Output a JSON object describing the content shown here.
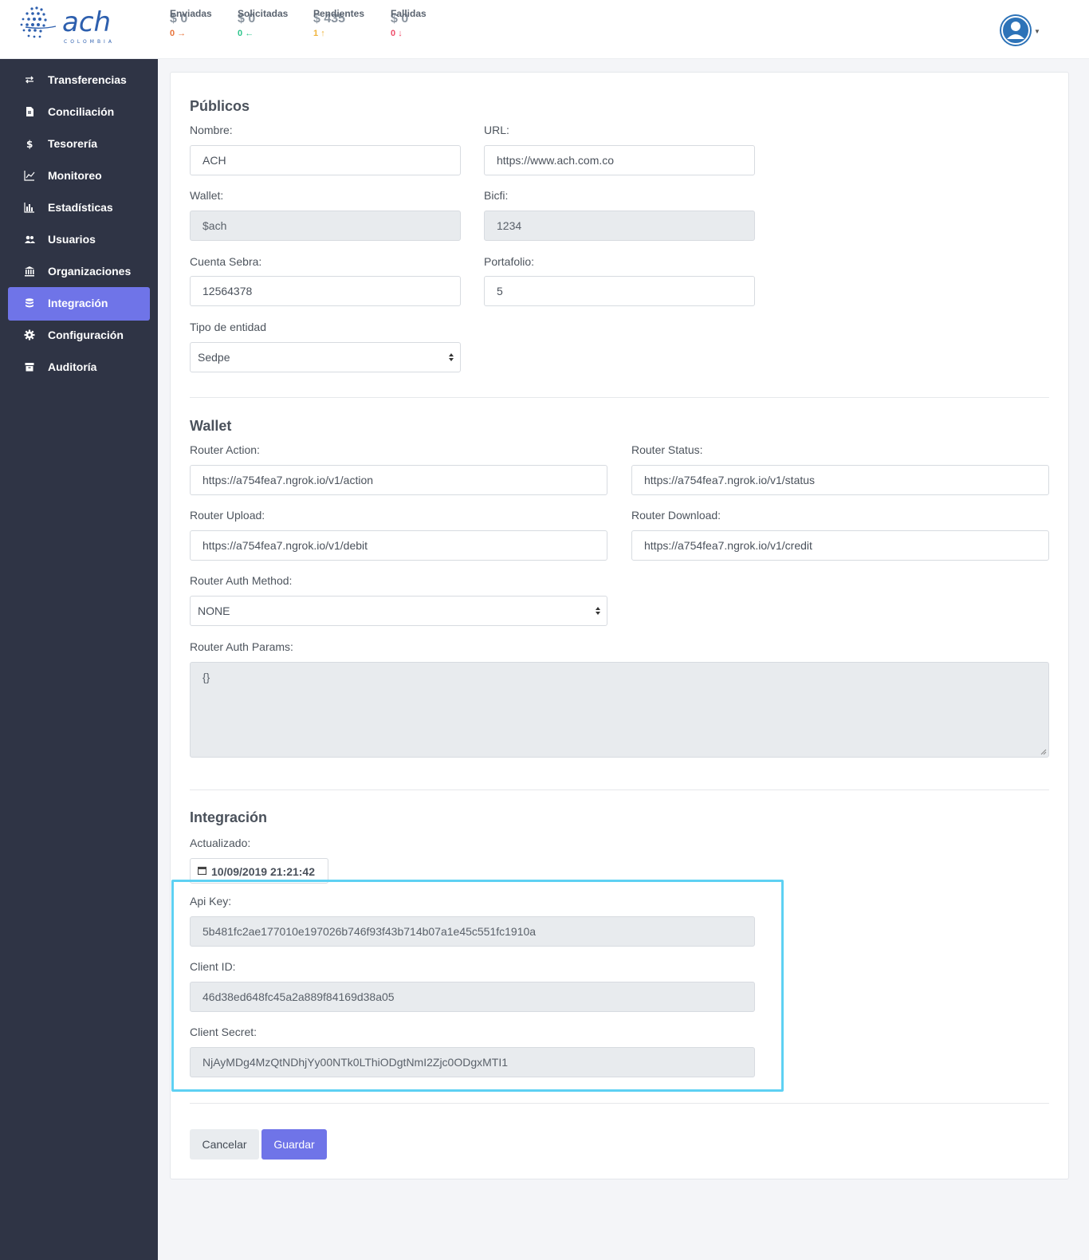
{
  "brand": {
    "logo_text": "ach",
    "logo_sub": "COLOMBIA"
  },
  "stats": [
    {
      "label": "Enviadas",
      "value": "$ 0",
      "count": "0",
      "arrow": "→",
      "color": "#e8743b"
    },
    {
      "label": "Solicitadas",
      "value": "$ 0",
      "count": "0",
      "arrow": "←",
      "color": "#2dc58c"
    },
    {
      "label": "Pendientes",
      "value": "$ 435",
      "count": "1",
      "arrow": "↑",
      "color": "#f0b43c"
    },
    {
      "label": "Fallidas",
      "value": "$ 0",
      "count": "0",
      "arrow": "↓",
      "color": "#ee4d6a"
    }
  ],
  "sidebar": {
    "items": [
      {
        "label": "Transferencias",
        "icon": "transfer-icon"
      },
      {
        "label": "Conciliación",
        "icon": "document-icon"
      },
      {
        "label": "Tesorería",
        "icon": "dollar-icon"
      },
      {
        "label": "Monitoreo",
        "icon": "line-chart-icon"
      },
      {
        "label": "Estadísticas",
        "icon": "bar-chart-icon"
      },
      {
        "label": "Usuarios",
        "icon": "users-icon"
      },
      {
        "label": "Organizaciones",
        "icon": "bank-icon"
      },
      {
        "label": "Integración",
        "icon": "database-icon",
        "active": true
      },
      {
        "label": "Configuración",
        "icon": "gear-icon"
      },
      {
        "label": "Auditoría",
        "icon": "archive-icon"
      }
    ]
  },
  "publicos": {
    "title": "Públicos",
    "nombre_label": "Nombre:",
    "nombre_value": "ACH",
    "url_label": "URL:",
    "url_value": "https://www.ach.com.co",
    "wallet_label": "Wallet:",
    "wallet_value": "$ach",
    "bicfi_label": "Bicfi:",
    "bicfi_value": "1234",
    "cuenta_label": "Cuenta Sebra:",
    "cuenta_value": "12564378",
    "portafolio_label": "Portafolio:",
    "portafolio_value": "5",
    "tipo_label": "Tipo de entidad",
    "tipo_value": "Sedpe"
  },
  "wallet": {
    "title": "Wallet",
    "action_label": "Router Action:",
    "action_value": "https://a754fea7.ngrok.io/v1/action",
    "status_label": "Router Status:",
    "status_value": "https://a754fea7.ngrok.io/v1/status",
    "upload_label": "Router Upload:",
    "upload_value": "https://a754fea7.ngrok.io/v1/debit",
    "download_label": "Router Download:",
    "download_value": "https://a754fea7.ngrok.io/v1/credit",
    "auth_method_label": "Router Auth Method:",
    "auth_method_value": "NONE",
    "auth_params_label": "Router Auth Params:",
    "auth_params_value": "{}"
  },
  "integracion": {
    "title": "Integración",
    "updated_label": "Actualizado:",
    "updated_value": "10/09/2019 21:21:42",
    "apikey_label": "Api Key:",
    "apikey_value": "5b481fc2ae177010e197026b746f93f43b714b07a1e45c551fc1910a",
    "clientid_label": "Client ID:",
    "clientid_value": "46d38ed648fc45a2a889f84169d38a05",
    "secret_label": "Client Secret:",
    "secret_value": "NjAyMDg4MzQtNDhjYy00NTk0LThiODgtNmI2Zjc0ODgxMTI1"
  },
  "actions": {
    "cancel_label": "Cancelar",
    "save_label": "Guardar"
  },
  "colors": {
    "accent": "#6f74e8",
    "sidebar_bg": "#2f3445",
    "highlight": "#5ed1f3",
    "avatar": "#2d73b8"
  }
}
